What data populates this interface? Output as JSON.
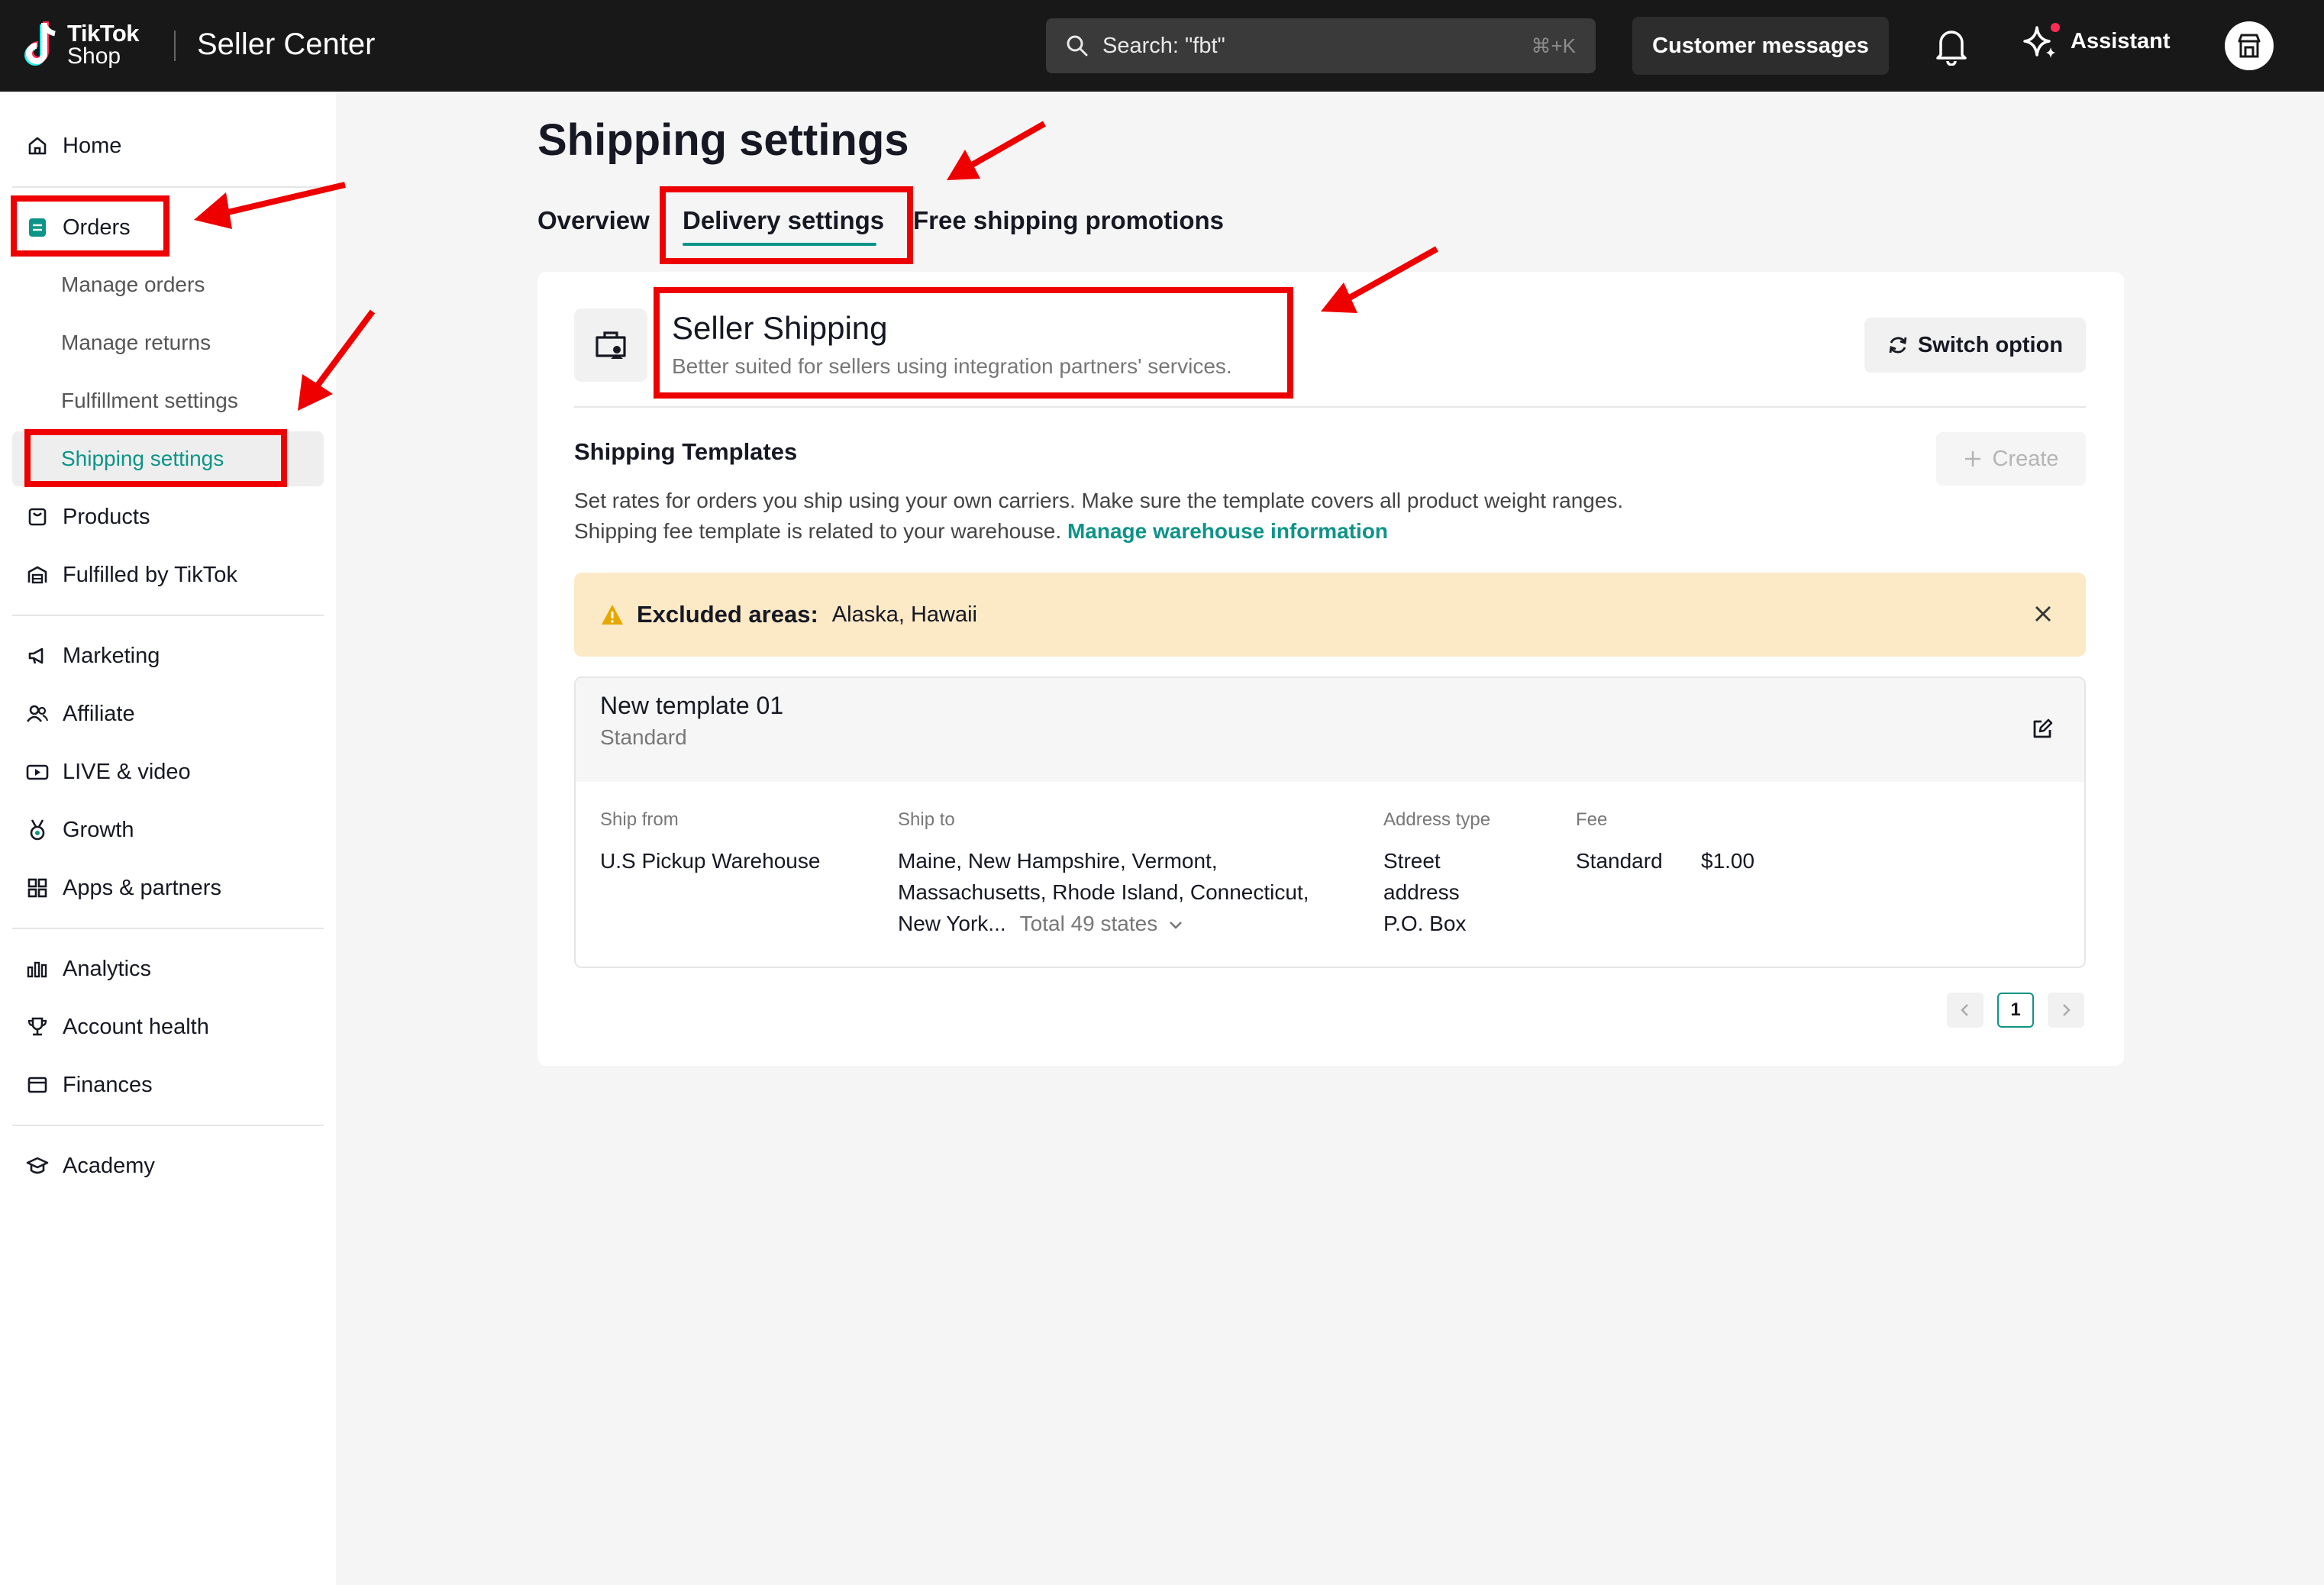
{
  "header": {
    "logo_line1": "TikTok",
    "logo_line2": "Shop",
    "app_title": "Seller Center",
    "search_placeholder": "Search: \"fbt\"",
    "search_shortcut": "⌘+K",
    "customer_messages": "Customer messages",
    "assistant": "Assistant"
  },
  "sidebar": {
    "home": "Home",
    "orders": "Orders",
    "manage_orders": "Manage orders",
    "manage_returns": "Manage returns",
    "fulfillment_settings": "Fulfillment settings",
    "shipping_settings": "Shipping settings",
    "products": "Products",
    "fulfilled_by_tiktok": "Fulfilled by TikTok",
    "marketing": "Marketing",
    "affiliate": "Affiliate",
    "live_video": "LIVE & video",
    "growth": "Growth",
    "apps_partners": "Apps & partners",
    "analytics": "Analytics",
    "account_health": "Account health",
    "finances": "Finances",
    "academy": "Academy"
  },
  "main": {
    "title": "Shipping settings",
    "tabs": {
      "overview": "Overview",
      "delivery": "Delivery settings",
      "free_shipping": "Free shipping promotions"
    },
    "seller_shipping": {
      "title": "Seller Shipping",
      "subtitle": "Better suited for sellers using integration partners' services.",
      "switch_option": "Switch option"
    },
    "templates": {
      "heading": "Shipping Templates",
      "create": "Create",
      "desc_line1": "Set rates for orders you ship using your own carriers. Make sure the template covers all product weight ranges.",
      "desc_line2": "Shipping fee template is related to your warehouse.",
      "desc_link": "Manage warehouse information"
    },
    "alert": {
      "label": "Excluded areas:",
      "value": "Alaska, Hawaii"
    },
    "template": {
      "name": "New template 01",
      "type": "Standard",
      "col_ship_from": "Ship from",
      "col_ship_to": "Ship to",
      "col_address_type": "Address type",
      "col_fee": "Fee",
      "ship_from": "U.S Pickup Warehouse",
      "ship_to_line1": "Maine, New Hampshire, Vermont,",
      "ship_to_line2": "Massachusetts, Rhode Island, Connecticut,",
      "ship_to_line3": "New York...",
      "ship_to_total": "Total 49 states",
      "address_line1": "Street",
      "address_line2": "address",
      "address_line3": "P.O. Box",
      "fee_type": "Standard",
      "fee_value": "$1.00"
    },
    "pagination": {
      "current": "1"
    }
  },
  "colors": {
    "accent": "#0d9488",
    "annotation_red": "#ee0000",
    "alert_bg": "#fce9c6"
  }
}
